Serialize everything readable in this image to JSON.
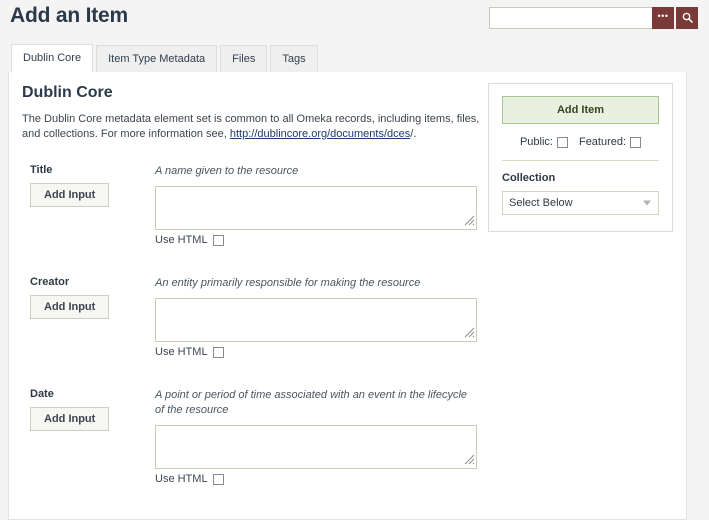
{
  "header": {
    "title": "Add an Item",
    "search": {
      "value": "",
      "placeholder": "",
      "advanced_icon": "dots-icon",
      "advanced_label": "•••",
      "submit_icon": "search-icon"
    }
  },
  "tabs": [
    {
      "label": "Dublin Core",
      "active": true
    },
    {
      "label": "Item Type Metadata",
      "active": false
    },
    {
      "label": "Files",
      "active": false
    },
    {
      "label": "Tags",
      "active": false
    }
  ],
  "main": {
    "section_title": "Dublin Core",
    "description_before": "The Dublin Core metadata element set is common to all Omeka records, including items, files, and collections. For more information see, ",
    "description_link": "http://dublincore.org/documents/dces",
    "description_after": "/.",
    "add_input_label": "Add Input",
    "use_html_label": "Use HTML",
    "fields": [
      {
        "label": "Title",
        "description": "A name given to the resource",
        "value": "",
        "use_html_checked": false
      },
      {
        "label": "Creator",
        "description": "An entity primarily responsible for making the resource",
        "value": "",
        "use_html_checked": false
      },
      {
        "label": "Date",
        "description": "A point or period of time associated with an event in the lifecycle of the resource",
        "value": "",
        "use_html_checked": false
      }
    ]
  },
  "side_panel": {
    "add_item_label": "Add Item",
    "public_label": "Public:",
    "public_checked": false,
    "featured_label": "Featured:",
    "featured_checked": false,
    "collection_label": "Collection",
    "collection_selected": "Select Below",
    "collection_options": [
      "Select Below"
    ]
  },
  "colors": {
    "page_background": "#f4f4f4",
    "panel_background": "#ffffff",
    "accent_maroon": "#7a3b38",
    "button_green_bg": "#e9f0df",
    "button_green_border": "#a9c58d",
    "link_blue": "#1e3a6e",
    "input_border": "#cbcbb6"
  }
}
